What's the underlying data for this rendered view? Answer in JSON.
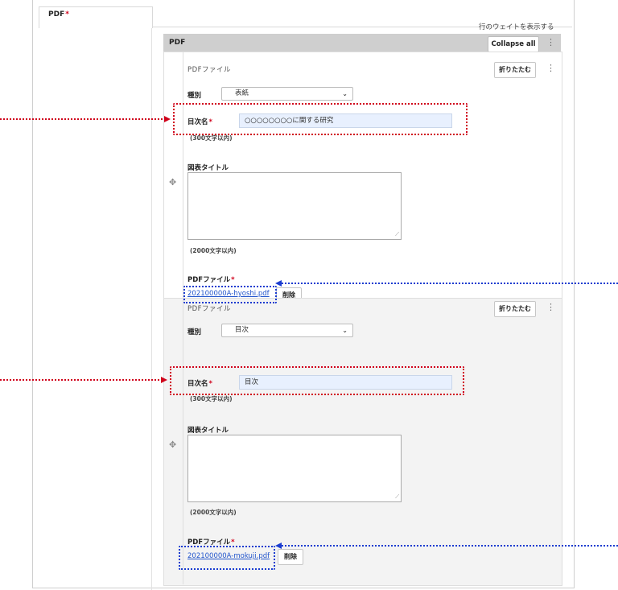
{
  "tab": {
    "label": "PDF",
    "required_mark": "*"
  },
  "weight_link": "行のウェイトを表示する",
  "table": {
    "header_label": "PDF",
    "collapse_all": "Collapse all",
    "kebab": "⋮"
  },
  "items": [
    {
      "title": "PDFファイル",
      "fold_label": "折りたたむ",
      "type_label": "種別",
      "type_value": "表紙",
      "toc_label": "目次名",
      "toc_required": "*",
      "toc_value": "○○○○○○○○に関する研究",
      "toc_hint": "(300文字以内)",
      "fig_label": "図表タイトル",
      "fig_hint": "(2000文字以内)",
      "pdf_label": "PDFファイル",
      "pdf_required": "*",
      "file_name": "202100000A-hyoshi.pdf",
      "delete_label": "削除"
    },
    {
      "title": "PDFファイル",
      "fold_label": "折りたたむ",
      "type_label": "種別",
      "type_value": "目次",
      "toc_label": "目次名",
      "toc_required": "*",
      "toc_value": "目次",
      "toc_hint": "(300文字以内)",
      "fig_label": "図表タイトル",
      "fig_hint": "(2000文字以内)",
      "pdf_label": "PDFファイル",
      "pdf_required": "*",
      "file_name": "202100000A-mokuji.pdf",
      "delete_label": "削除"
    }
  ],
  "icons": {
    "drag_handle": "✥",
    "chevron": "⌄",
    "resize_grip": "⟋"
  },
  "colors": {
    "annotation_red": "#d0021b",
    "annotation_blue": "#1a3cd0",
    "link": "#2255cc",
    "input_bg": "#e8f0fe"
  }
}
